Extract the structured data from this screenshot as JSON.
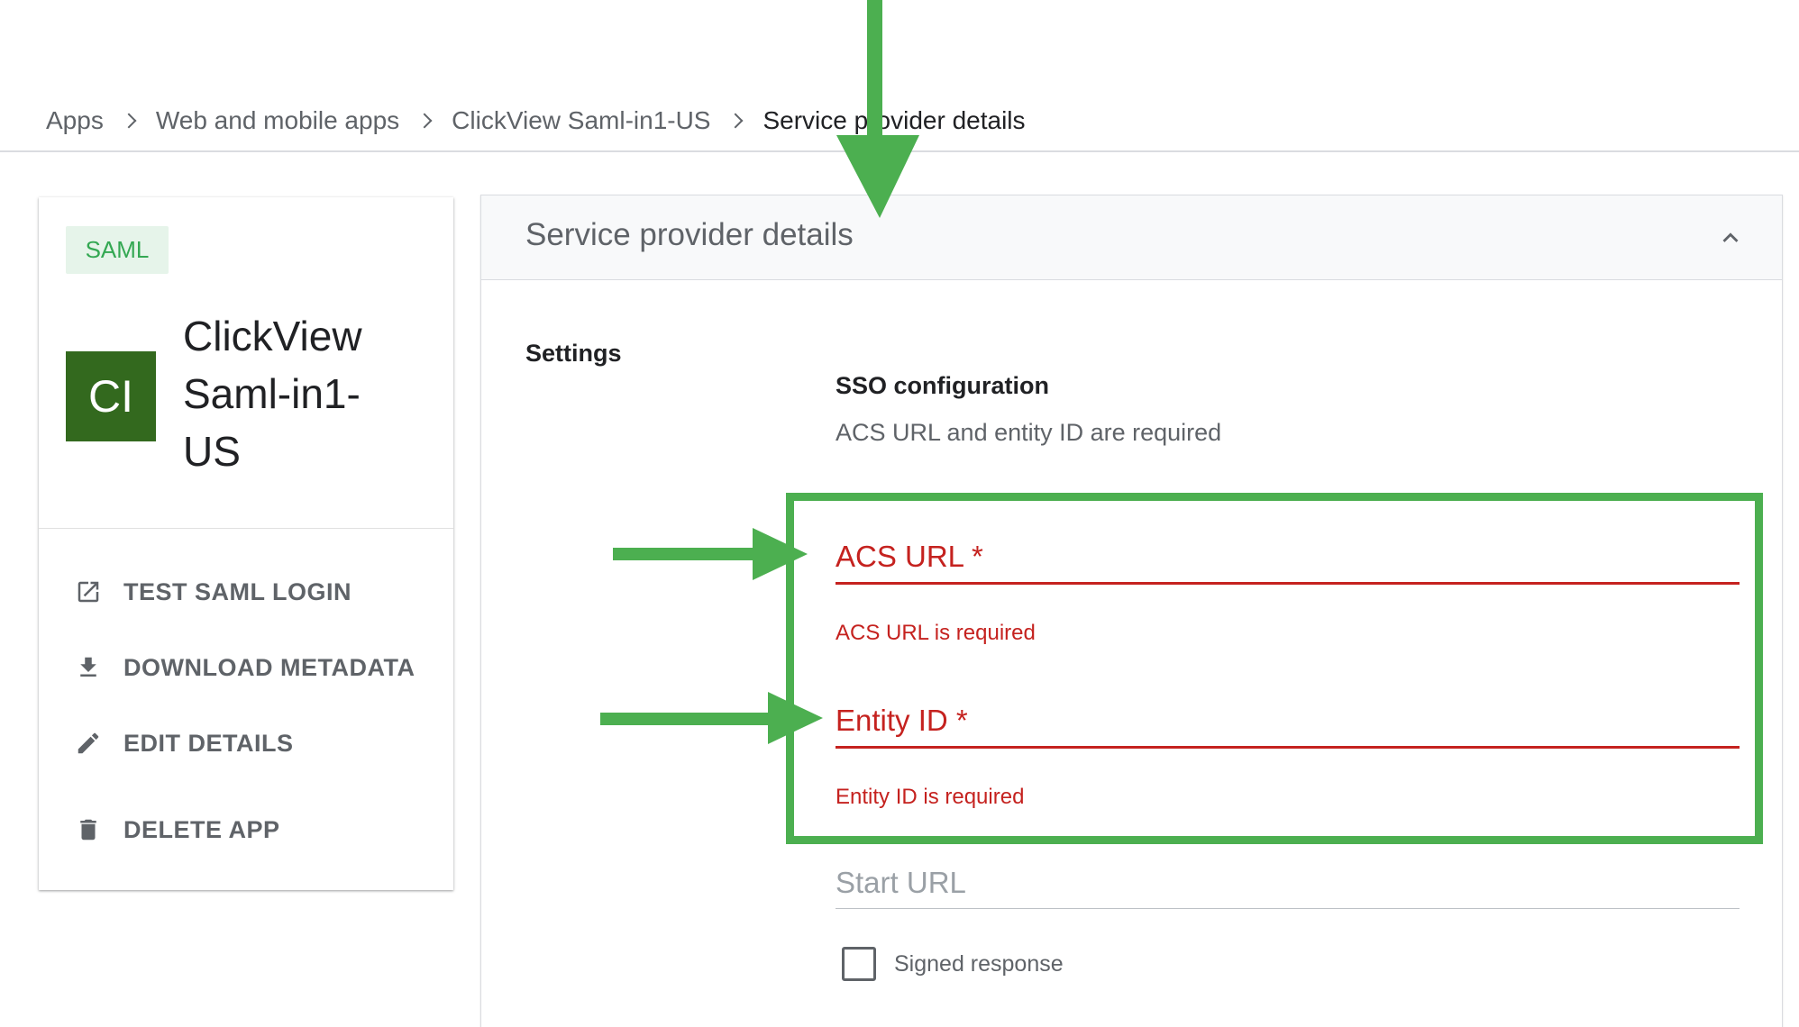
{
  "breadcrumb": [
    {
      "label": "Apps",
      "current": false
    },
    {
      "label": "Web and mobile apps",
      "current": false
    },
    {
      "label": "ClickView Saml-in1-US",
      "current": false
    },
    {
      "label": "Service provider details",
      "current": true
    }
  ],
  "app": {
    "chip": "SAML",
    "avatar_initials": "CI",
    "avatar_color": "#33691e",
    "name_lines": [
      "ClickView",
      "Saml-in1-",
      "US"
    ],
    "actions": [
      {
        "icon": "open-in-new-icon",
        "label": "TEST SAML LOGIN"
      },
      {
        "icon": "download-icon",
        "label": "DOWNLOAD METADATA"
      },
      {
        "icon": "edit-pencil-icon",
        "label": "EDIT DETAILS"
      },
      {
        "icon": "trash-icon",
        "label": "DELETE APP"
      }
    ]
  },
  "panel": {
    "title": "Service provider details",
    "collapse_icon": "chevron-up-icon",
    "settings_label": "Settings",
    "sso": {
      "title": "SSO configuration",
      "subtitle": "ACS URL and entity ID are required"
    },
    "fields": {
      "acs_url": {
        "label": "ACS URL *",
        "error": "ACS URL is required",
        "value": ""
      },
      "entity_id": {
        "label": "Entity ID *",
        "error": "Entity ID is required",
        "value": ""
      },
      "start_url": {
        "label": "Start URL",
        "value": ""
      }
    },
    "signed_response": {
      "label": "Signed response",
      "checked": false
    }
  },
  "colors": {
    "error": "#c5221f",
    "annotation": "#4caf50",
    "chip_bg": "#e6f4ea",
    "chip_text": "#34a853"
  }
}
